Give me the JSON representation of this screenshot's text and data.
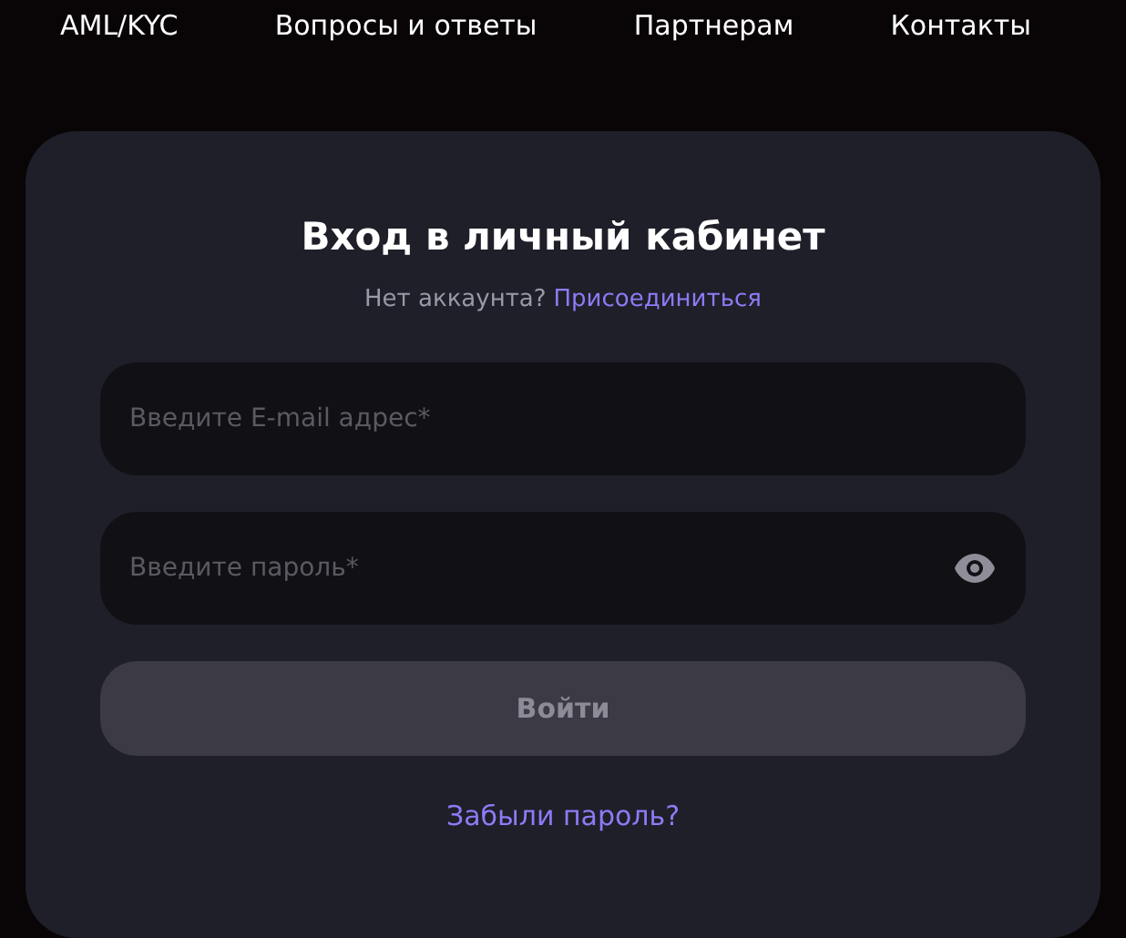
{
  "nav": [
    {
      "label": "AML/KYC"
    },
    {
      "label": "Вопросы и ответы"
    },
    {
      "label": "Партнерам"
    },
    {
      "label": "Контакты"
    }
  ],
  "login": {
    "title": "Вход в личный кабинет",
    "prompt": "Нет аккаунта?",
    "join_link": "Присоединиться",
    "fields": [
      {
        "kind": "email",
        "placeholder": "Введите E-mail адрес*"
      },
      {
        "kind": "password",
        "placeholder": "Введите пароль*"
      }
    ],
    "submit": {
      "label": "Войти",
      "disabled": true
    },
    "forgot_link": "Забыли пароль?"
  }
}
